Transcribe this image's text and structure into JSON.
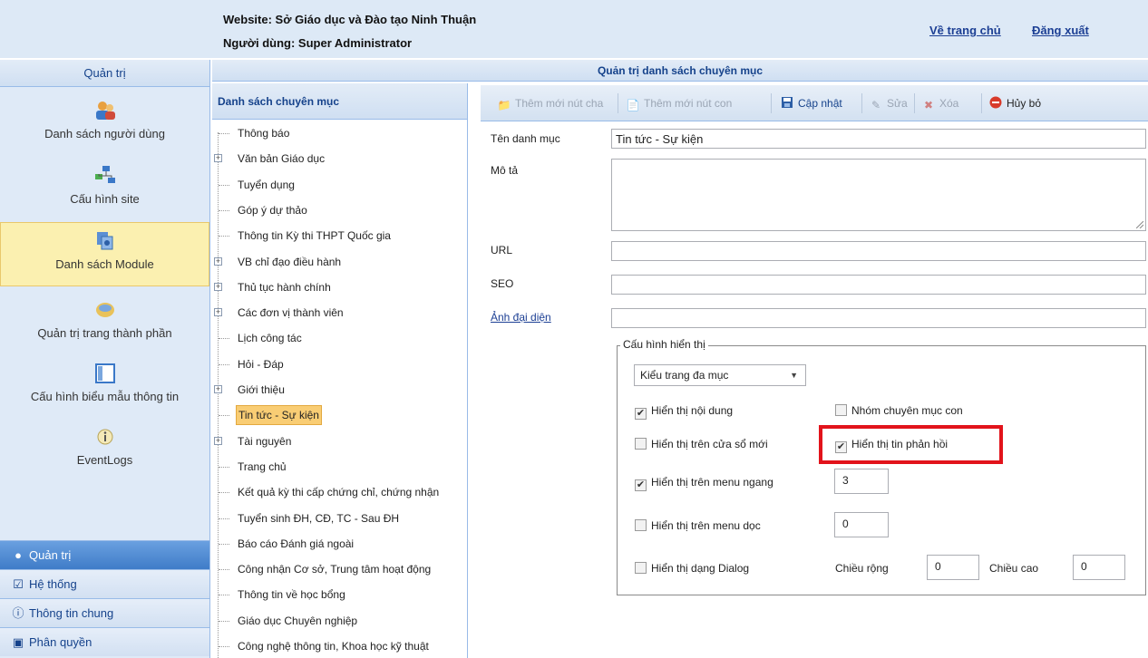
{
  "header": {
    "website": "Website: Sở Giáo dục và Đào tạo Ninh Thuận",
    "user": "Người dùng: Super Administrator",
    "home_link": "Về trang chủ",
    "logout_link": "Đăng xuất"
  },
  "left": {
    "title": "Quản trị",
    "items": [
      {
        "label": "Danh sách người dùng",
        "icon": "users-icon"
      },
      {
        "label": "Cấu hình site",
        "icon": "sitemap-icon"
      },
      {
        "label": "Danh sách Module",
        "icon": "module-icon"
      },
      {
        "label": "Quản trị trang thành phần",
        "icon": "components-icon"
      },
      {
        "label": "Cấu hình biểu mẫu thông tin",
        "icon": "form-layout-icon"
      },
      {
        "label": "EventLogs",
        "icon": "info-icon"
      }
    ],
    "bottom_nav": [
      {
        "label": "Quản trị",
        "icon": "admin-icon"
      },
      {
        "label": "Hệ thống",
        "icon": "system-icon"
      },
      {
        "label": "Thông tin chung",
        "icon": "info-icon"
      },
      {
        "label": "Phân quyền",
        "icon": "permissions-icon"
      }
    ]
  },
  "main": {
    "title": "Quản trị danh sách chuyên mục"
  },
  "tree": {
    "title": "Danh sách chuyên mục",
    "items": [
      {
        "label": "Thông báo",
        "expandable": false
      },
      {
        "label": "Văn bản Giáo dục",
        "expandable": true
      },
      {
        "label": "Tuyển dụng",
        "expandable": false
      },
      {
        "label": "Góp ý dự thảo",
        "expandable": false
      },
      {
        "label": "Thông tin Kỳ thi THPT Quốc gia",
        "expandable": false
      },
      {
        "label": "VB chỉ đạo điều hành",
        "expandable": true
      },
      {
        "label": "Thủ tục hành chính",
        "expandable": true
      },
      {
        "label": "Các đơn vị thành viên",
        "expandable": true
      },
      {
        "label": "Lịch công tác",
        "expandable": false
      },
      {
        "label": "Hỏi - Đáp",
        "expandable": false
      },
      {
        "label": "Giới thiệu",
        "expandable": true
      },
      {
        "label": "Tin tức - Sự kiện",
        "expandable": false,
        "selected": true
      },
      {
        "label": "Tài nguyên",
        "expandable": true
      },
      {
        "label": "Trang chủ",
        "expandable": false
      },
      {
        "label": "Kết quả kỳ thi cấp chứng chỉ, chứng nhận",
        "expandable": false
      },
      {
        "label": "Tuyển sinh ĐH, CĐ, TC - Sau ĐH",
        "expandable": false
      },
      {
        "label": "Báo cáo Đánh giá ngoài",
        "expandable": false
      },
      {
        "label": "Công nhận Cơ sở, Trung tâm hoạt động",
        "expandable": false
      },
      {
        "label": "Thông tin về học bổng",
        "expandable": false
      },
      {
        "label": "Giáo dục Chuyên nghiệp",
        "expandable": false
      },
      {
        "label": "Công nghệ thông tin, Khoa học kỹ thuật",
        "expandable": false
      }
    ]
  },
  "toolbar": {
    "add_parent": "Thêm mới nút cha",
    "add_child": "Thêm mới nút con",
    "update": "Cập nhật",
    "edit": "Sửa",
    "delete": "Xóa",
    "cancel": "Hủy bỏ"
  },
  "form": {
    "name_label": "Tên danh mục",
    "name_value": "Tin tức - Sự kiện",
    "desc_label": "Mô tả",
    "url_label": "URL",
    "seo_label": "SEO",
    "image_label": "Ảnh đại diện",
    "display_legend": "Cấu hình hiển thị",
    "page_type": "Kiểu trang đa mục",
    "show_content": "Hiển thị nội dung",
    "sub_category_group": "Nhóm chuyên mục con",
    "show_new_window": "Hiển thị trên cửa sổ mới",
    "show_feedback": "Hiển thị tin phản hồi",
    "show_horizontal_menu": "Hiển thị trên menu ngang",
    "horizontal_menu_value": "3",
    "show_vertical_menu": "Hiển thị trên menu dọc",
    "vertical_menu_value": "0",
    "show_dialog": "Hiển thị dạng Dialog",
    "width_label": "Chiều rộng",
    "width_value": "0",
    "height_label": "Chiều cao",
    "height_value": "0",
    "checked": {
      "show_content": true,
      "sub_category_group": false,
      "show_new_window": false,
      "show_feedback": true,
      "show_horizontal_menu": true,
      "show_vertical_menu": false,
      "show_dialog": false
    }
  },
  "colors": {
    "highlight_box": "#e2131b",
    "selected_tree_item": "#f9cd74",
    "active_module": "#fbf0b0"
  }
}
